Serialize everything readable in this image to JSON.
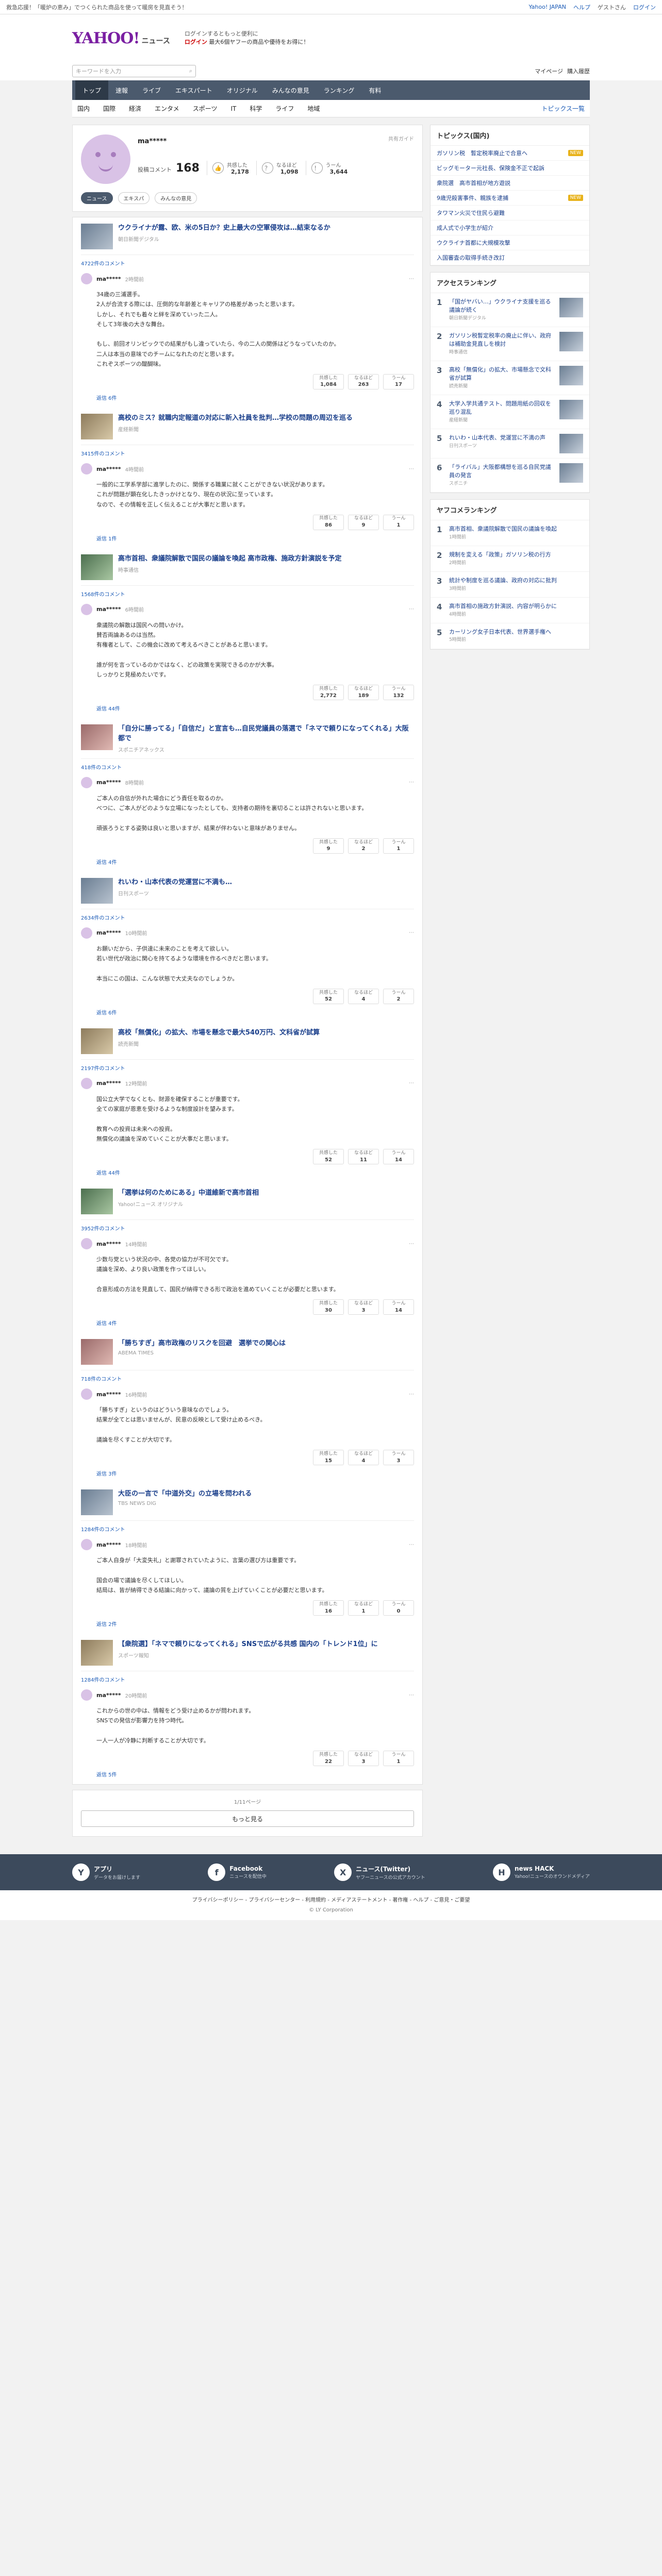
{
  "topbar": {
    "notice": "救急応援！「暖炉の恵み」でつくられた商品を使って暖房を見直そう！",
    "links": [
      "Yahoo! JAPAN",
      "ヘルプ"
    ],
    "user_label": "ゲストさん",
    "login_label": "ログイン"
  },
  "header": {
    "logo": "YAHOO!",
    "logo_sub": "ニュース",
    "promo_line1": "ログインするともっと便利に",
    "promo_login": "ログイン",
    "promo_line2": "最大6個ヤフーの商品や優待をお得に！"
  },
  "search": {
    "placeholder": "キーワードを入力",
    "links": [
      "マイページ",
      "購入履歴"
    ],
    "button": "検索"
  },
  "nav": [
    "トップ",
    "速報",
    "ライブ",
    "エキスパート",
    "オリジナル",
    "みんなの意見",
    "ランキング",
    "有料"
  ],
  "subnav": [
    "国内",
    "国際",
    "経済",
    "エンタメ",
    "スポーツ",
    "IT",
    "科学",
    "ライフ",
    "地域"
  ],
  "subnav_right": "トピックス一覧",
  "profile": {
    "name": "ma*****",
    "info": "共有ガイド",
    "comment_label": "投稿コメント",
    "comment_count": "168",
    "stats": [
      {
        "icon": "いいね",
        "label": "共感した",
        "value": "2,178"
      },
      {
        "icon": "？",
        "label": "なるほど",
        "value": "1,098"
      },
      {
        "icon": "！",
        "label": "うーん",
        "value": "3,644"
      }
    ],
    "tabs": [
      "ニュース",
      "エキスパ",
      "みんなの意見"
    ]
  },
  "entries": [
    {
      "title": "ウクライナが露、欧、米の5日か？史上最大の空軍侵攻は…結束なるか",
      "source": "朝日新聞デジタル",
      "ccount": "4722件のコメント",
      "user": "ma*****",
      "time": "2時間前",
      "text": "34歳の三浦選手。\n2人が合流する際には、圧倒的な年齢差とキャリアの格差があったと思います。\nしかし、それでも着々と絆を深めていった二人。\nそして3年後の大きな舞台。\n\nもし、前回オリンピックでの結果がもし違っていたら、今の二人の関係はどうなっていたのか。\n二人は本当の意味でのチームになれたのだと思います。\nこれぞスポーツの醍醐味。",
      "likes": [
        "1,084",
        "263",
        "17"
      ],
      "replies": "返信 6件"
    },
    {
      "title": "高校のミス？就職内定報道の対応に新入社員を批判…学校の問題の周辺を巡る",
      "source": "産経新聞",
      "ccount": "3415件のコメント",
      "user": "ma*****",
      "time": "4時間前",
      "text": "一般的に工学系学部に進学したのに、関係する職業に就くことができない状況があります。\nこれが問題が顕在化したきっかけとなり、現在の状況に至っています。\nなので、その情報を正しく伝えることが大事だと思います。",
      "likes": [
        "86",
        "9",
        "1"
      ],
      "replies": "返信 1件"
    },
    {
      "title": "高市首相、衆議院解散で国民の議論を喚起 高市政権、施政方針演説を予定",
      "source": "時事通信",
      "ccount": "1568件のコメント",
      "user": "ma*****",
      "time": "6時間前",
      "text": "衆議院の解散は国民への問いかけ。\n賛否両論あるのは当然。\n有権者として、この機会に改めて考えるべきことがあると思います。\n\n誰が何を言っているのかではなく、どの政策を実現できるのかが大事。\nしっかりと見極めたいです。",
      "likes": [
        "2,772",
        "189",
        "132"
      ],
      "replies": "返信 44件"
    },
    {
      "title": "「自分に勝ってる」「自信だ」と宣言も…自民党議員の落選で「ネマで頼りになってくれる」大阪都で",
      "source": "スポニチアネックス",
      "ccount": "418件のコメント",
      "user": "ma*****",
      "time": "8時間前",
      "text": "ご本人の自信が外れた場合にどう責任を取るのか。\nべつに、ご本人がどのような立場になったとしても、支持者の期待を裏切ることは許されないと思います。\n\n頑張ろうとする姿勢は良いと思いますが、結果が伴わないと意味がありません。",
      "likes": [
        "9",
        "2",
        "1"
      ],
      "replies": "返信 4件"
    },
    {
      "title": "れいわ・山本代表の党運営に不満も…",
      "source": "日刊スポーツ",
      "ccount": "2634件のコメント",
      "user": "ma*****",
      "time": "10時間前",
      "text": "お願いだから、子供達に未来のことを考えて欲しい。\n若い世代が政治に関心を持てるような環境を作るべきだと思います。\n\n本当にこの国は、こんな状態で大丈夫なのでしょうか。",
      "likes": [
        "52",
        "4",
        "2"
      ],
      "replies": "返信 6件"
    },
    {
      "title": "高校「無償化」の拡大、市場を懸念で最大540万円、文科省が試算",
      "source": "読売新聞",
      "ccount": "2197件のコメント",
      "user": "ma*****",
      "time": "12時間前",
      "text": "国公立大学でなくとも、財源を確保することが重要です。\n全ての家庭が恩恵を受けるような制度設計を望みます。\n\n教育への投資は未来への投資。\n無償化の議論を深めていくことが大事だと思います。",
      "likes": [
        "52",
        "11",
        "14"
      ],
      "replies": "返信 44件"
    },
    {
      "title": "「選挙は何のためにある」中道維新で高市首相",
      "source": "Yahoo!ニュース オリジナル",
      "ccount": "3952件のコメント",
      "user": "ma*****",
      "time": "14時間前",
      "text": "少数与党という状況の中、各党の協力が不可欠です。\n議論を深め、より良い政策を作ってほしい。\n\n合意形成の方法を見直して、国民が納得できる形で政治を進めていくことが必要だと思います。",
      "likes": [
        "30",
        "3",
        "14"
      ],
      "replies": "返信 4件"
    },
    {
      "title": "「勝ちすぎ」高市政権のリスクを回避　選挙での関心は",
      "source": "ABEMA TIMES",
      "ccount": "718件のコメント",
      "user": "ma*****",
      "time": "16時間前",
      "text": "「勝ちすぎ」というのはどういう意味なのでしょう。\n結果が全てとは思いませんが、民意の反映として受け止めるべき。\n\n議論を尽くすことが大切です。",
      "likes": [
        "15",
        "4",
        "3"
      ],
      "replies": "返信 3件"
    },
    {
      "title": "大臣の一言で「中道外交」の立場を問われる",
      "source": "TBS NEWS DIG",
      "ccount": "1284件のコメント",
      "user": "ma*****",
      "time": "18時間前",
      "text": "ご本人自身が「大変失礼」と謝罪されていたように、言葉の選び方は重要です。\n\n国会の場で議論を尽くしてほしい。\n結局は、皆が納得できる結論に向かって、議論の質を上げていくことが必要だと思います。",
      "likes": [
        "16",
        "1",
        "0"
      ],
      "replies": "返信 2件"
    },
    {
      "title": "【衆院選】「ネマで頼りになってくれる」SNSで広がる共感 国内の「トレンド1位」に",
      "source": "スポーツ報知",
      "ccount": "1284件のコメント",
      "user": "ma*****",
      "time": "20時間前",
      "text": "これからの世の中は、情報をどう受け止めるかが問われます。\nSNSでの発信が影響力を持つ時代。\n\n一人一人が冷静に判断することが大切です。",
      "likes": [
        "22",
        "3",
        "1"
      ],
      "replies": "返信 5件"
    }
  ],
  "pager": "1/11ページ",
  "more_button": "もっと見る",
  "side": {
    "topics_head": "トピックス(国内)",
    "topics": [
      {
        "t": "ガソリン税　暫定税率廃止で合意へ",
        "b": "NEW"
      },
      {
        "t": "ビッグモーター元社長、保険金不正で起訴",
        "b": ""
      },
      {
        "t": "衆院選　高市首相が地方遊説",
        "b": ""
      },
      {
        "t": "9歳児殺害事件、親族を逮捕",
        "b": "NEW"
      },
      {
        "t": "タワマン火災で住民ら避難",
        "b": ""
      },
      {
        "t": "成人式で小学生が紹介",
        "b": ""
      },
      {
        "t": "ウクライナ首都に大規模攻撃",
        "b": ""
      },
      {
        "t": "入国審査の取得手続き改訂",
        "b": ""
      }
    ],
    "ranking_head": "アクセスランキング",
    "ranking": [
      {
        "n": "1",
        "t": "「国がヤバい…」ウクライナ支援を巡る議論が続く",
        "s": "朝日新聞デジタル"
      },
      {
        "n": "2",
        "t": "ガソリン税暫定税率の廃止に伴い、政府は補助金見直しを検討",
        "s": "時事通信"
      },
      {
        "n": "3",
        "t": "高校「無償化」の拡大、市場懸念で文科省が試算",
        "s": "読売新聞"
      },
      {
        "n": "4",
        "t": "大学入学共通テスト、問題用紙の回収を巡り混乱",
        "s": "産経新聞"
      },
      {
        "n": "5",
        "t": "れいわ・山本代表、党運営に不満の声",
        "s": "日刊スポーツ"
      },
      {
        "n": "6",
        "t": "「ライバル」大阪都構想を巡る自民党議員の発言",
        "s": "スポニチ"
      }
    ],
    "comment_head": "ヤフコメランキング",
    "comments": [
      {
        "n": "1",
        "t": "高市首相、衆議院解散で国民の議論を喚起",
        "s": "1時間前"
      },
      {
        "n": "2",
        "t": "規制を変える「政策」ガソリン税の行方",
        "s": "2時間前"
      },
      {
        "n": "3",
        "t": "統計や制度を巡る議論、政府の対応に批判",
        "s": "3時間前"
      },
      {
        "n": "4",
        "t": "高市首相の施政方針演説、内容が明らかに",
        "s": "4時間前"
      },
      {
        "n": "5",
        "t": "カーリング女子日本代表、世界選手権へ",
        "s": "5時間前"
      }
    ]
  },
  "footer": {
    "apps": [
      {
        "ic": "Y",
        "t": "アプリ",
        "s": "データをお届けします"
      },
      {
        "ic": "f",
        "t": "Facebook",
        "s": "ニュースを配信中"
      },
      {
        "ic": "X",
        "t": "ニュース(Twitter)",
        "s": "ヤフーニュースの公式アカウント"
      },
      {
        "ic": "H",
        "t": "news HACK",
        "s": "Yahoo!ニュースのオウンドメディア"
      }
    ],
    "nav": "プライバシーポリシー - プライバシーセンター - 利用規約 - メディアステートメント - 著作権 - ヘルプ - ご意見・ご要望",
    "copy": "© LY Corporation"
  }
}
